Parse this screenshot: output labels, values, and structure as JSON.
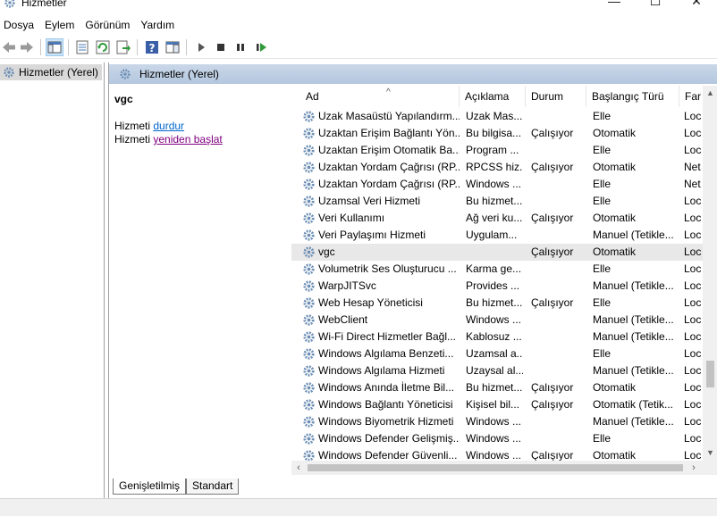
{
  "window": {
    "title": "Hizmetler"
  },
  "menu": [
    "Dosya",
    "Eylem",
    "Görünüm",
    "Yardım"
  ],
  "tree": {
    "root_label": "Hizmetler (Yerel)"
  },
  "main": {
    "header": "Hizmetler (Yerel)",
    "selected_service": "vgc",
    "actions": [
      {
        "prefix": "Hizmeti",
        "link": "durdur"
      },
      {
        "prefix": "Hizmeti",
        "link": "yeniden başlat"
      }
    ]
  },
  "columns": [
    "Ad",
    "Açıklama",
    "Durum",
    "Başlangıç Türü",
    "Far"
  ],
  "rows": [
    {
      "name": "Uzak Masaüstü Yapılandırm...",
      "desc": "Uzak Mas...",
      "status": "",
      "start": "Elle",
      "logon": "Loc"
    },
    {
      "name": "Uzaktan Erişim Bağlantı Yön...",
      "desc": "Bu bilgisa...",
      "status": "Çalışıyor",
      "start": "Otomatik",
      "logon": "Loc"
    },
    {
      "name": "Uzaktan Erişim Otomatik Ba...",
      "desc": "Program ...",
      "status": "",
      "start": "Elle",
      "logon": "Loc"
    },
    {
      "name": "Uzaktan Yordam Çağrısı (RP...",
      "desc": "RPCSS hiz...",
      "status": "Çalışıyor",
      "start": "Otomatik",
      "logon": "Net"
    },
    {
      "name": "Uzaktan Yordam Çağrısı (RP...",
      "desc": "Windows ...",
      "status": "",
      "start": "Elle",
      "logon": "Net"
    },
    {
      "name": "Uzamsal Veri Hizmeti",
      "desc": "Bu hizmet...",
      "status": "",
      "start": "Elle",
      "logon": "Loc"
    },
    {
      "name": "Veri Kullanımı",
      "desc": "Ağ veri ku...",
      "status": "Çalışıyor",
      "start": "Otomatik",
      "logon": "Loc"
    },
    {
      "name": "Veri Paylaşımı Hizmeti",
      "desc": "Uygulam...",
      "status": "",
      "start": "Manuel (Tetikle...",
      "logon": "Loc"
    },
    {
      "name": "vgc",
      "desc": "",
      "status": "Çalışıyor",
      "start": "Otomatik",
      "logon": "Loc",
      "selected": true
    },
    {
      "name": "Volumetrik Ses Oluşturucu ...",
      "desc": "Karma ge...",
      "status": "",
      "start": "Elle",
      "logon": "Loc"
    },
    {
      "name": "WarpJITSvc",
      "desc": "Provides ...",
      "status": "",
      "start": "Manuel (Tetikle...",
      "logon": "Loc"
    },
    {
      "name": "Web Hesap Yöneticisi",
      "desc": "Bu hizmet...",
      "status": "Çalışıyor",
      "start": "Elle",
      "logon": "Loc"
    },
    {
      "name": "WebClient",
      "desc": "Windows ...",
      "status": "",
      "start": "Manuel (Tetikle...",
      "logon": "Loc"
    },
    {
      "name": "Wi-Fi Direct Hizmetler Bağl...",
      "desc": "Kablosuz ...",
      "status": "",
      "start": "Manuel (Tetikle...",
      "logon": "Loc"
    },
    {
      "name": "Windows Algılama Benzeti...",
      "desc": "Uzamsal a...",
      "status": "",
      "start": "Elle",
      "logon": "Loc"
    },
    {
      "name": "Windows Algılama Hizmeti",
      "desc": "Uzaysal al...",
      "status": "",
      "start": "Manuel (Tetikle...",
      "logon": "Loc"
    },
    {
      "name": "Windows Anında İletme Bil...",
      "desc": "Bu hizmet...",
      "status": "Çalışıyor",
      "start": "Otomatik",
      "logon": "Loc"
    },
    {
      "name": "Windows Bağlantı Yöneticisi",
      "desc": "Kişisel bil...",
      "status": "Çalışıyor",
      "start": "Otomatik (Tetik...",
      "logon": "Loc"
    },
    {
      "name": "Windows Biyometrik Hizmeti",
      "desc": "Windows ...",
      "status": "",
      "start": "Manuel (Tetikle...",
      "logon": "Loc"
    },
    {
      "name": "Windows Defender Gelişmiş...",
      "desc": "Windows ...",
      "status": "",
      "start": "Elle",
      "logon": "Loc"
    },
    {
      "name": "Windows Defender Güvenli...",
      "desc": "Windows ...",
      "status": "Çalışıyor",
      "start": "Otomatik",
      "logon": "Loc"
    }
  ],
  "tabs": [
    "Genişletilmiş",
    "Standart"
  ],
  "icons": {
    "window": "gear-icon",
    "nav": [
      "back-arrow-icon",
      "forward-arrow-icon"
    ],
    "toolbar": [
      "console-tree-icon",
      "properties-icon",
      "refresh-icon",
      "export-list-icon",
      "help-icon",
      "show-hide-pane-icon",
      "start-icon",
      "stop-icon",
      "pause-icon",
      "resume-icon"
    ]
  },
  "colors": {
    "header_bg": "#b4c7de",
    "selected_row": "#e8e8e8",
    "tree_selected": "#d9d9d9",
    "link_stop": "#0066cc",
    "link_restart": "#800080"
  }
}
